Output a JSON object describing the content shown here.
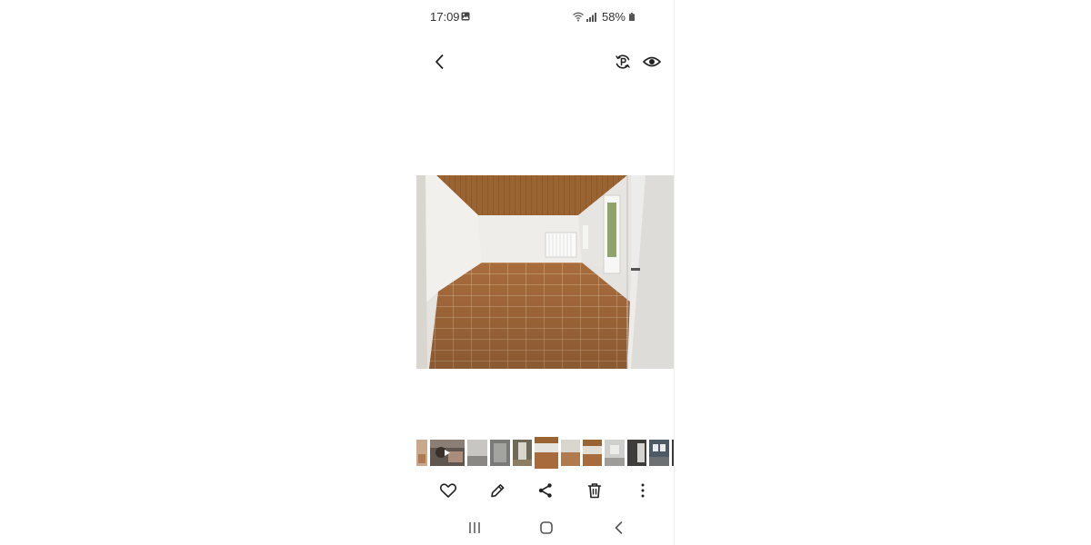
{
  "status_bar": {
    "time": "17:09",
    "battery_percent": "58%",
    "icons": [
      "gallery-notification-icon",
      "wifi-icon",
      "signal-icon",
      "battery-icon"
    ]
  },
  "top_bar": {
    "buttons": [
      "back-icon",
      "remaster-icon",
      "eye-icon"
    ]
  },
  "filmstrip": {
    "thumbnail_count": 13,
    "selected_index": 6
  },
  "action_bar": {
    "buttons": [
      "favorite-icon",
      "edit-icon",
      "share-icon",
      "delete-icon",
      "more-options-icon"
    ]
  },
  "nav_bar": {
    "buttons": [
      "recents-icon",
      "home-icon",
      "back-nav-icon"
    ]
  },
  "colors": {
    "background": "#ffffff",
    "icon": "#222222",
    "status_text": "#333333"
  }
}
